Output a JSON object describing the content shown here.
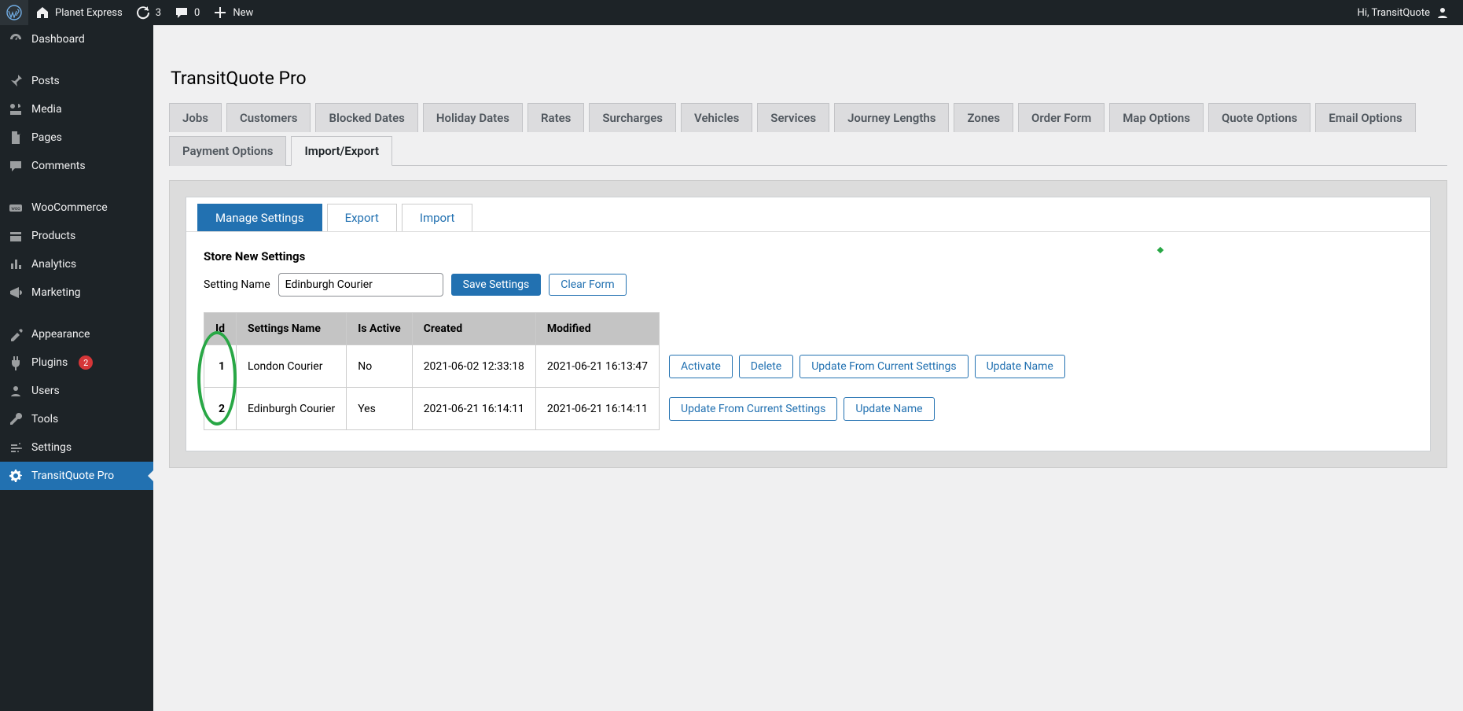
{
  "adminbar": {
    "site_name": "Planet Express",
    "updates_count": "3",
    "comments_count": "0",
    "new_label": "New",
    "greeting": "Hi, TransitQuote"
  },
  "sidebar": {
    "items": [
      {
        "icon": "dashboard",
        "label": "Dashboard"
      },
      {
        "sep": true
      },
      {
        "icon": "pin",
        "label": "Posts"
      },
      {
        "icon": "media",
        "label": "Media"
      },
      {
        "icon": "page",
        "label": "Pages"
      },
      {
        "icon": "comment",
        "label": "Comments"
      },
      {
        "sep": true
      },
      {
        "icon": "woo",
        "label": "WooCommerce"
      },
      {
        "icon": "products",
        "label": "Products"
      },
      {
        "icon": "analytics",
        "label": "Analytics"
      },
      {
        "icon": "marketing",
        "label": "Marketing"
      },
      {
        "sep": true
      },
      {
        "icon": "appearance",
        "label": "Appearance"
      },
      {
        "icon": "plugin",
        "label": "Plugins",
        "badge": "2"
      },
      {
        "icon": "users",
        "label": "Users"
      },
      {
        "icon": "tools",
        "label": "Tools"
      },
      {
        "icon": "settings",
        "label": "Settings"
      },
      {
        "icon": "gear",
        "label": "TransitQuote Pro",
        "current": true
      }
    ]
  },
  "page": {
    "title": "TransitQuote Pro"
  },
  "tabs": {
    "items": [
      "Jobs",
      "Customers",
      "Blocked Dates",
      "Holiday Dates",
      "Rates",
      "Surcharges",
      "Vehicles",
      "Services",
      "Journey Lengths",
      "Zones",
      "Order Form",
      "Map Options",
      "Quote Options",
      "Email Options",
      "Payment Options",
      "Import/Export"
    ],
    "active": "Import/Export"
  },
  "subtabs": {
    "items": [
      "Manage Settings",
      "Export",
      "Import"
    ],
    "active": "Manage Settings"
  },
  "store": {
    "heading": "Store New Settings",
    "setting_name_label": "Setting Name",
    "setting_name_value": "Edinburgh Courier",
    "save_label": "Save Settings",
    "clear_label": "Clear Form"
  },
  "table": {
    "headers": [
      "Id",
      "Settings Name",
      "Is Active",
      "Created",
      "Modified"
    ],
    "rows": [
      {
        "id": "1",
        "name": "London Courier",
        "active": "No",
        "created": "2021-06-02 12:33:18",
        "modified": "2021-06-21 16:13:47",
        "actions": [
          "Activate",
          "Delete",
          "Update From Current Settings",
          "Update Name"
        ]
      },
      {
        "id": "2",
        "name": "Edinburgh Courier",
        "active": "Yes",
        "created": "2021-06-21 16:14:11",
        "modified": "2021-06-21 16:14:11",
        "actions": [
          "Update From Current Settings",
          "Update Name"
        ]
      }
    ]
  }
}
